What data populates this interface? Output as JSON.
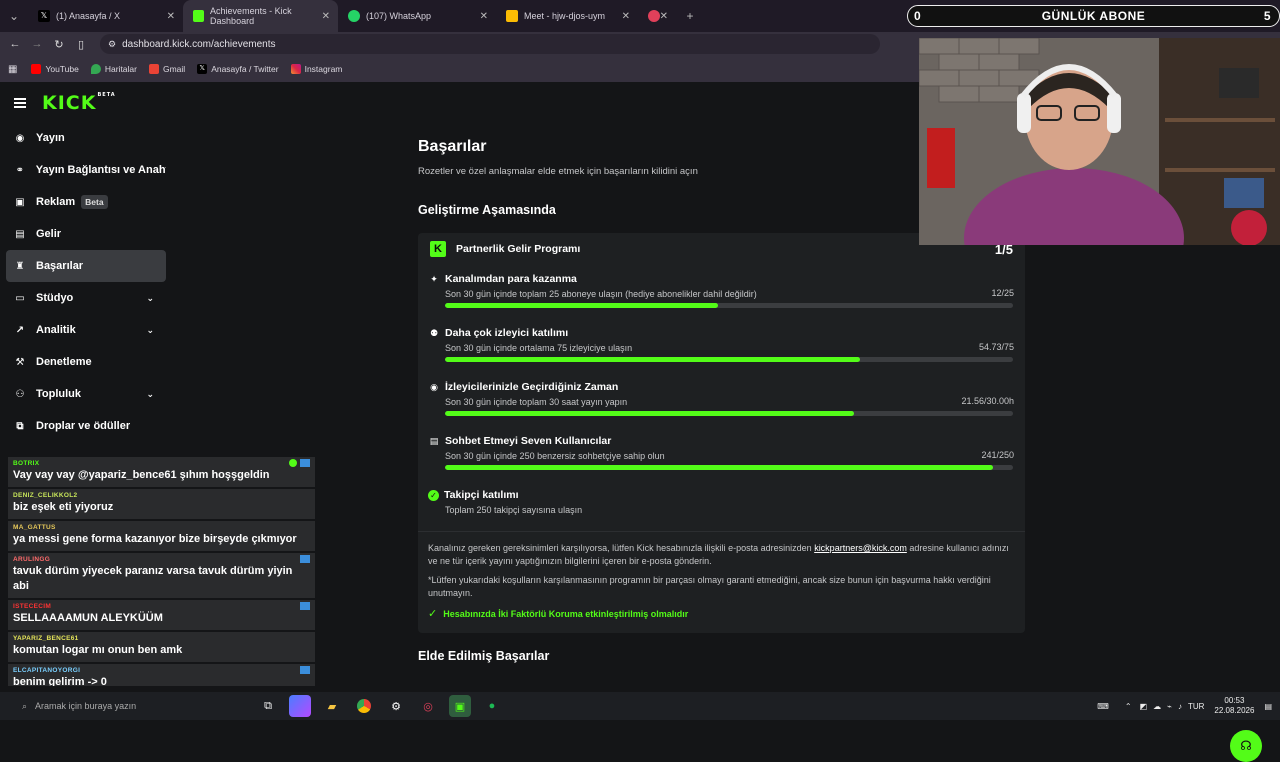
{
  "browser": {
    "tabs": [
      {
        "title": "(1) Anasayfa / X",
        "icon": "x-icon",
        "color": "#000000",
        "active": false
      },
      {
        "title": "Achievements - Kick Dashboard",
        "icon": "kick-icon",
        "color": "#53fc18",
        "active": true
      },
      {
        "title": "(107) WhatsApp",
        "icon": "whatsapp-icon",
        "color": "#25d366",
        "active": false
      },
      {
        "title": "Meet - hjw-djos-uym",
        "icon": "meet-icon",
        "color": "#fbbc04",
        "active": false
      }
    ],
    "url": "dashboard.kick.com/achievements",
    "bookmarks": [
      {
        "label": "YouTube",
        "color": "#ff0000"
      },
      {
        "label": "Haritalar",
        "color": "#34a853"
      },
      {
        "label": "Gmail",
        "color": "#ea4335"
      },
      {
        "label": "Anasayfa / Twitter",
        "color": "#ffffff"
      },
      {
        "label": "Instagram",
        "color": "#e1306c"
      }
    ]
  },
  "sidebar": {
    "logo": "KICK",
    "logo_sup": "BETA",
    "items": [
      {
        "label": "Yayın",
        "icon": "broadcast-icon"
      },
      {
        "label": "Yayın Bağlantısı ve Anahtar",
        "icon": "link-icon"
      },
      {
        "label": "Reklam",
        "icon": "ad-icon",
        "badge": "Beta"
      },
      {
        "label": "Gelir",
        "icon": "revenue-icon"
      },
      {
        "label": "Başarılar",
        "icon": "trophy-icon",
        "active": true
      },
      {
        "label": "Stüdyo",
        "icon": "studio-icon",
        "expand": true
      },
      {
        "label": "Analitik",
        "icon": "analytics-icon",
        "expand": true
      },
      {
        "label": "Denetleme",
        "icon": "wrench-icon"
      },
      {
        "label": "Topluluk",
        "icon": "community-icon",
        "expand": true
      },
      {
        "label": "Droplar ve ödüller",
        "icon": "drops-icon"
      }
    ]
  },
  "main": {
    "title": "Başarılar",
    "subtitle": "Rozetler ve özel anlaşmalar elde etmek için başarıların kilidini açın",
    "section_title": "Geliştirme Aşamasında",
    "program": {
      "title": "Partnerlik Gelir Programı",
      "count": "1/5",
      "tasks": [
        {
          "title": "Kanalımdan para kazanma",
          "desc": "Son 30 gün içinde toplam 25 aboneye ulaşın (hediye abonelikler dahil değildir)",
          "value": "12/25",
          "progress": 0.48,
          "icon": "sparkle-icon"
        },
        {
          "title": "Daha çok izleyici katılımı",
          "desc": "Son 30 gün içinde ortalama 75 izleyiciye ulaşın",
          "value": "54.73/75",
          "progress": 0.73,
          "icon": "viewers-icon"
        },
        {
          "title": "İzleyicilerinizle Geçirdiğiniz Zaman",
          "desc": "Son 30 gün içinde toplam 30 saat yayın yapın",
          "value": "21.56/30.00h",
          "progress": 0.72,
          "icon": "live-icon"
        },
        {
          "title": "Sohbet Etmeyi Seven Kullanıcılar",
          "desc": "Son 30 gün içinde 250 benzersiz sohbetçiye sahip olun",
          "value": "241/250",
          "progress": 0.964,
          "icon": "chat-icon"
        }
      ],
      "completed": {
        "title": "Takipçi katılımı",
        "desc": "Toplam 250 takipçi sayısına ulaşın"
      },
      "footer_pre": "Kanalınız gereken gereksinimleri karşılıyorsa, lütfen Kick hesabınızla ilişkili e-posta adresinizden ",
      "footer_link": "kickpartners@kick.com",
      "footer_post": " adresine kullanıcı adınızı ve ne tür içerik yayını yaptığınızın bilgilerini içeren bir e-posta gönderin.",
      "footer_note": "*Lütfen yukarıdaki koşulların karşılanmasının programın bir parçası olmayı garanti etmediğini, ancak size bunun için başvurma hakkı verdiğini unutmayın.",
      "footer_ok": "Hesabınızda İki Faktörlü Koruma etkinleştirilmiş olmalıdır"
    },
    "section2_title": "Elde Edilmiş Başarılar"
  },
  "chat": [
    {
      "user": "BOTRIX",
      "color": "#53fc18",
      "text": "Vay vay vay @yapariz_bence61 şıhım hoşşgeldin"
    },
    {
      "user": "DENIZ_CELIKKOL2",
      "color": "#c8e65a",
      "text": "biz eşek eti yiyoruz"
    },
    {
      "user": "MA_GATTUS",
      "color": "#e6c85a",
      "text": "ya messi gene forma kazanıyor bize birşeyde çıkmıyor"
    },
    {
      "user": "ARULINGG",
      "color": "#ff6b6b",
      "text": "tavuk dürüm yiyecek paranız varsa tavuk dürüm yiyin abi"
    },
    {
      "user": "ISTECECIM",
      "color": "#ff3333",
      "text": "SELLAAAAMUN ALEYKÜÜM"
    },
    {
      "user": "YAPARIZ_BENCE61",
      "color": "#e6e65a",
      "text": "komutan logar mı onun ben amk"
    },
    {
      "user": "ELCAPITANOYORGI",
      "color": "#7ad0ff",
      "text": "benim gelirim -> 0"
    }
  ],
  "overlay": {
    "label": "GÜNLÜK ABONE",
    "left": "0",
    "right": "5"
  },
  "taskbar": {
    "search_placeholder": "Aramak için buraya yazın",
    "lang": "TUR",
    "time": "00:53",
    "date": "22.08.2026"
  }
}
